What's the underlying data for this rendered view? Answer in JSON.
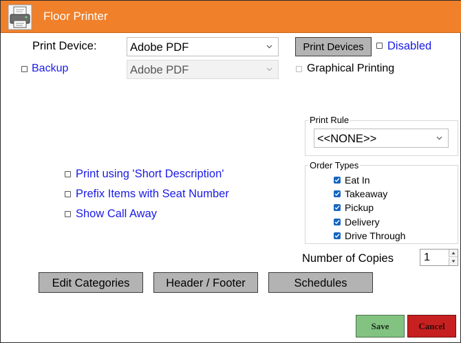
{
  "window": {
    "title": "Floor Printer",
    "accent_color": "#f0802a",
    "icon": "printer-icon"
  },
  "print_device": {
    "label": "Print Device:",
    "value": "Adobe PDF"
  },
  "print_devices_button": "Print Devices",
  "disabled": {
    "label": "Disabled",
    "checked": false
  },
  "backup": {
    "label": "Backup",
    "checked": false,
    "device_value": "Adobe PDF"
  },
  "graphical_printing": {
    "label": "Graphical Printing",
    "checked": false
  },
  "print_rule": {
    "title": "Print Rule",
    "value": "<<NONE>>"
  },
  "order_types": {
    "title": "Order Types",
    "items": [
      {
        "label": "Eat In",
        "checked": true
      },
      {
        "label": "Takeaway",
        "checked": true
      },
      {
        "label": "Pickup",
        "checked": true
      },
      {
        "label": "Delivery",
        "checked": true
      },
      {
        "label": "Drive Through",
        "checked": true
      }
    ]
  },
  "options": [
    {
      "label": "Print using 'Short Description'",
      "checked": false
    },
    {
      "label": "Prefix Items with Seat Number",
      "checked": false
    },
    {
      "label": "Show Call Away",
      "checked": false
    }
  ],
  "copies": {
    "label": "Number of Copies",
    "value": "1"
  },
  "buttons": {
    "edit_categories": "Edit Categories",
    "header_footer": "Header / Footer",
    "schedules": "Schedules",
    "save": "Save",
    "cancel": "Cancel"
  }
}
